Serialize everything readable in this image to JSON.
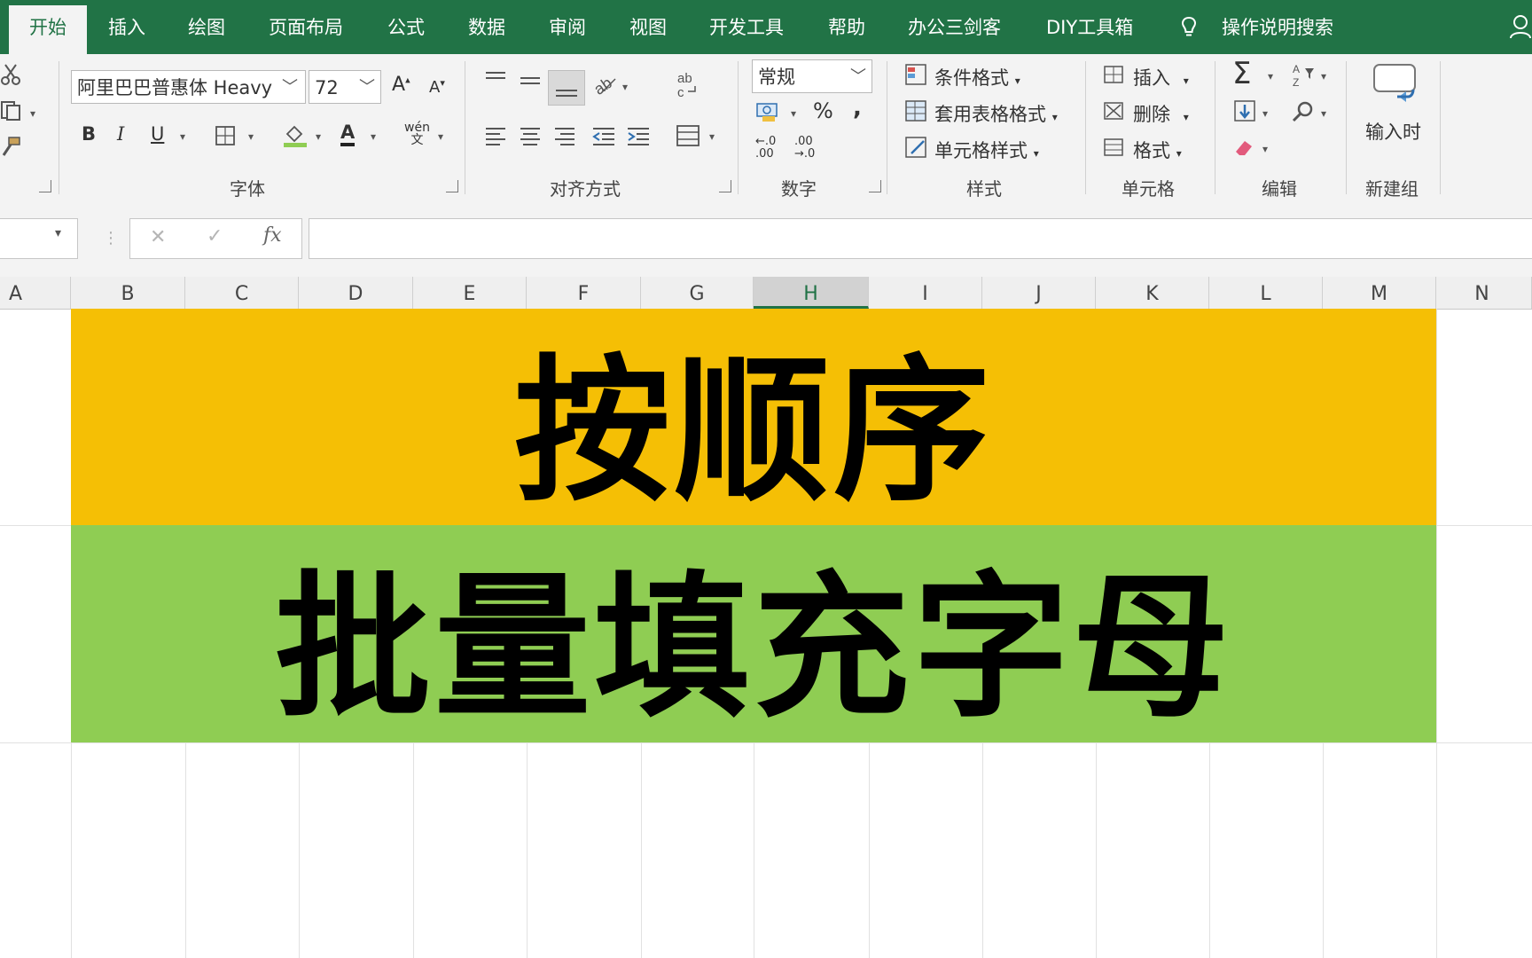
{
  "tabs": [
    "开始",
    "插入",
    "绘图",
    "页面布局",
    "公式",
    "数据",
    "审阅",
    "视图",
    "开发工具",
    "帮助",
    "办公三剑客",
    "DIY工具箱"
  ],
  "tell_me": "操作说明搜索",
  "font": {
    "name": "阿里巴巴普惠体 Heavy",
    "size": "72",
    "bold": "B",
    "italic": "I",
    "underline": "U",
    "font_color_letter": "A",
    "grow": "A",
    "shrink": "A",
    "phonetic_top": "wén",
    "phonetic_bottom": "文"
  },
  "groups": {
    "font": "字体",
    "alignment": "对齐方式",
    "number": "数字",
    "styles": "样式",
    "cells": "单元格",
    "editing": "编辑",
    "new_group": "新建组"
  },
  "number": {
    "format": "常规",
    "percent": "%",
    "comma": ",",
    "inc_dec": "←.0\n.00",
    "dec_dec": ".00\n→.0"
  },
  "styles": {
    "conditional": "条件格式",
    "table": "套用表格格式",
    "cell_styles": "单元格样式"
  },
  "cells": {
    "insert": "插入",
    "delete": "删除",
    "format": "格式"
  },
  "new_group": {
    "button": "输入时"
  },
  "formula_bar": {
    "cancel": "✕",
    "enter": "✓",
    "fx": "fx",
    "value": ""
  },
  "columns": [
    "A",
    "B",
    "C",
    "D",
    "E",
    "F",
    "G",
    "H",
    "I",
    "J",
    "K",
    "L",
    "M",
    "N"
  ],
  "selected_column": "H",
  "banners": {
    "line1": "按顺序",
    "line2": "批量填充字母",
    "line1_color": "#f5bf05",
    "line2_color": "#8fcd53"
  },
  "colors": {
    "accent": "#217346",
    "ribbon": "#f3f3f3"
  }
}
